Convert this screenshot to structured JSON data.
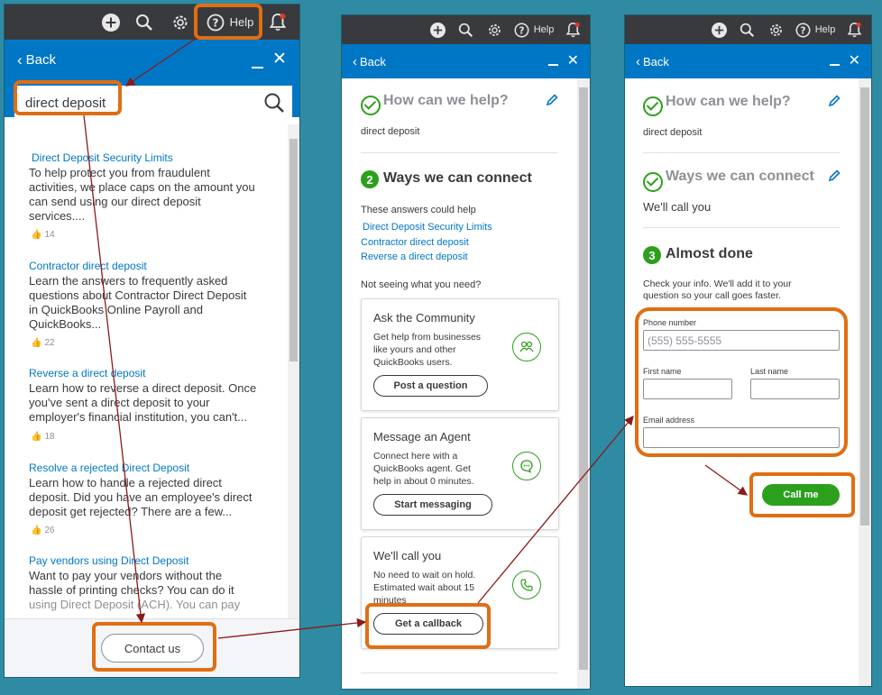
{
  "topbar": {
    "help_label": "Help"
  },
  "nav": {
    "back_label": "Back",
    "close_glyph": "✕"
  },
  "panel1": {
    "search_value": "direct deposit",
    "results": [
      {
        "title": "Direct Deposit Security Limits",
        "lines": [
          "To help protect you from fraudulent",
          "activities, we place caps on the amount you",
          "can send using our direct deposit",
          "services...."
        ],
        "likes": "14"
      },
      {
        "title": "Contractor direct deposit",
        "lines": [
          "Learn the answers to frequently asked",
          "questions about Contractor Direct Deposit",
          "in QuickBooks Online Payroll and",
          "QuickBooks..."
        ],
        "likes": "22"
      },
      {
        "title": "Reverse a direct deposit",
        "lines": [
          "Learn how to reverse a direct deposit. Once",
          "you've sent a direct deposit to your",
          "employer's financial institution, you can't..."
        ],
        "likes": "18"
      },
      {
        "title": "Resolve a rejected Direct Deposit",
        "lines": [
          "Learn how to handle a rejected direct",
          "deposit. Did you have an employee's direct",
          "deposit get rejected? There are a few..."
        ],
        "likes": "26"
      },
      {
        "title": "Pay vendors using Direct Deposit",
        "lines": [
          "Want to pay your vendors without the",
          "hassle of printing checks? You can do it",
          "using Direct Deposit (ACH). You can pay"
        ],
        "likes": ""
      }
    ],
    "contact_label": "Contact us"
  },
  "panel2": {
    "help_heading": "How can we help?",
    "help_answer": "direct deposit",
    "step_number": "2",
    "connect_heading": "Ways we can connect",
    "answers_intro": "These answers could help",
    "answer_links": [
      "Direct Deposit Security Limits",
      "Contractor direct deposit",
      "Reverse a direct deposit"
    ],
    "not_seeing": "Not seeing what you need?",
    "cards": [
      {
        "title": "Ask the Community",
        "lines": [
          "Get help from businesses",
          "like yours and other",
          "QuickBooks users."
        ],
        "button": "Post a question"
      },
      {
        "title": "Message an Agent",
        "lines": [
          "Connect here with a",
          "QuickBooks agent. Get",
          "help in about 0 minutes."
        ],
        "button": "Start messaging"
      },
      {
        "title": "We'll call you",
        "lines": [
          "No need to wait on hold.",
          "Estimated wait about 15",
          "minutes"
        ],
        "button": "Get a callback"
      }
    ]
  },
  "panel3": {
    "help_heading": "How can we help?",
    "help_answer": "direct deposit",
    "connect_heading": "Ways we can connect",
    "connect_answer": "We'll call you",
    "step_number": "3",
    "done_heading": "Almost done",
    "check_info": [
      "Check your info. We'll add it to your",
      "question so your call goes faster."
    ],
    "phone_label": "Phone number",
    "phone_placeholder": "(555) 555-5555",
    "first_name_label": "First name",
    "last_name_label": "Last name",
    "email_label": "Email address",
    "call_button": "Call me"
  },
  "colors": {
    "accent_blue": "#0077c5",
    "success_green": "#2ca01c",
    "highlight_orange": "#e06e12",
    "topbar_dark": "#393a3d"
  }
}
